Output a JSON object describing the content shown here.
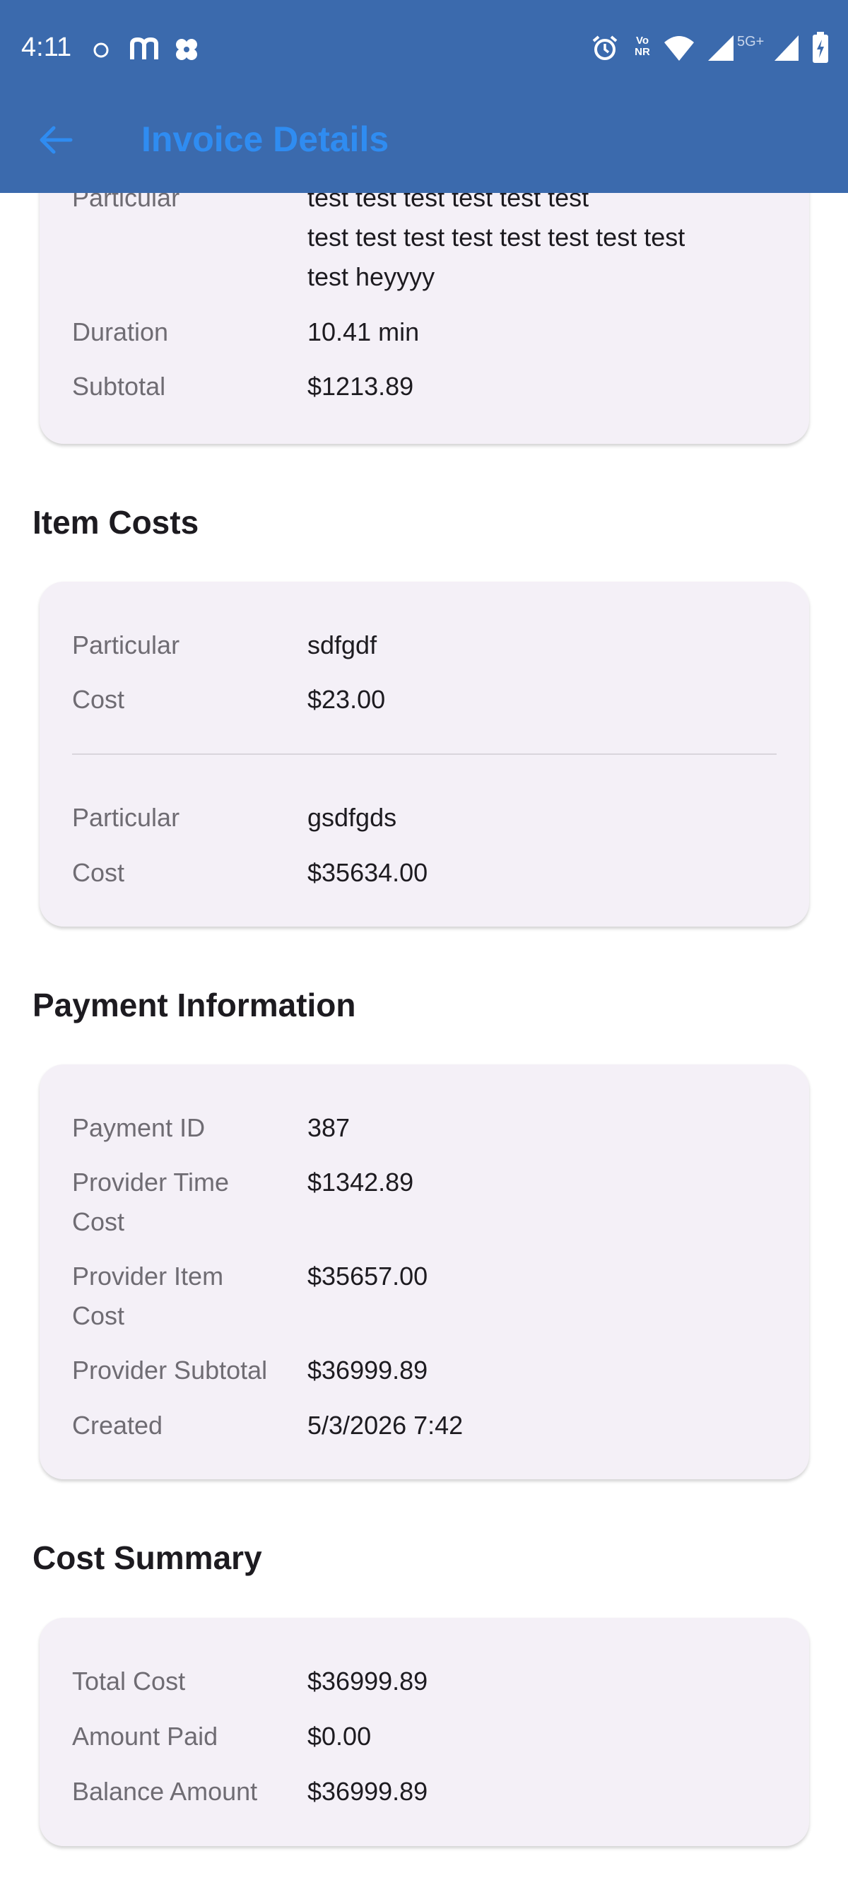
{
  "status_bar": {
    "time": "4:11",
    "icons": [
      "circle-icon",
      "m-app-icon",
      "flower-app-icon",
      "alarm-icon",
      "vonr-icon",
      "wifi-icon",
      "signal-icon",
      "5g-signal-icon",
      "battery-icon"
    ],
    "vonr_text": "Vo NR",
    "network_text": "5G+"
  },
  "header": {
    "title": "Invoice Details",
    "back_icon": "arrow-back-icon",
    "color": "#3b6aad",
    "title_color": "#2f8cf1"
  },
  "time_cost_card": {
    "particular_label": "Particular",
    "particular_lines": [
      "test test test test test test",
      "test test test test test test test test",
      "test heyyyy"
    ],
    "duration_label": "Duration",
    "duration_value": "10.41 min",
    "subtotal_label": "Subtotal",
    "subtotal_value": "$1213.89"
  },
  "item_costs": {
    "title": "Item Costs",
    "items": [
      {
        "particular_label": "Particular",
        "particular": "sdfgdf",
        "cost_label": "Cost",
        "cost": "$23.00"
      },
      {
        "particular_label": "Particular",
        "particular": "gsdfgds",
        "cost_label": "Cost",
        "cost": "$35634.00"
      }
    ]
  },
  "payment_information": {
    "title": "Payment Information",
    "payment_id_label": "Payment ID",
    "payment_id": "387",
    "provider_time_cost_label_1": "Provider Time",
    "provider_time_cost_label_2": "Cost",
    "provider_time_cost": "$1342.89",
    "provider_item_cost_label_1": "Provider Item",
    "provider_item_cost_label_2": "Cost",
    "provider_item_cost": "$35657.00",
    "provider_subtotal_label": "Provider Subtotal",
    "provider_subtotal": "$36999.89",
    "created_label": "Created",
    "created": "5/3/2026 7:42"
  },
  "cost_summary": {
    "title": "Cost Summary",
    "total_cost_label": "Total Cost",
    "total_cost": "$36999.89",
    "amount_paid_label": "Amount Paid",
    "amount_paid": "$0.00",
    "balance_amount_label": "Balance Amount",
    "balance_amount": "$36999.89"
  }
}
